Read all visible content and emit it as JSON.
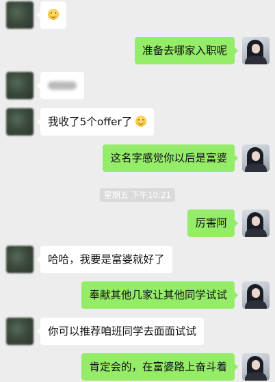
{
  "messages": [
    {
      "side": "in",
      "type": "emoji",
      "text": ""
    },
    {
      "side": "out",
      "type": "text",
      "text": "准备去哪家入职呢"
    },
    {
      "side": "in",
      "type": "blurred",
      "text": ""
    },
    {
      "side": "in",
      "type": "text_emoji",
      "text": "我收了5个offer了"
    },
    {
      "side": "out",
      "type": "text",
      "text": "这名字感觉你以后是富婆"
    },
    {
      "side": "out",
      "type": "text",
      "text": "厉害阿"
    },
    {
      "side": "in",
      "type": "text",
      "text": "哈哈，我要是富婆就好了"
    },
    {
      "side": "out",
      "type": "text",
      "text": "奉献其他几家让其他同学试试"
    },
    {
      "side": "in",
      "type": "text",
      "text": "你可以推荐咱班同学去面面试试"
    },
    {
      "side": "out",
      "type": "text",
      "text": "肯定会的，在富婆路上奋斗着"
    }
  ],
  "timestamp": "星期五 下午10:21",
  "colors": {
    "background": "#ededed",
    "outgoing": "#95ec69",
    "incoming": "#ffffff",
    "timestamp_bg": "#dadada"
  },
  "icons": {
    "emoji": "smiling-face-emoji-icon"
  }
}
